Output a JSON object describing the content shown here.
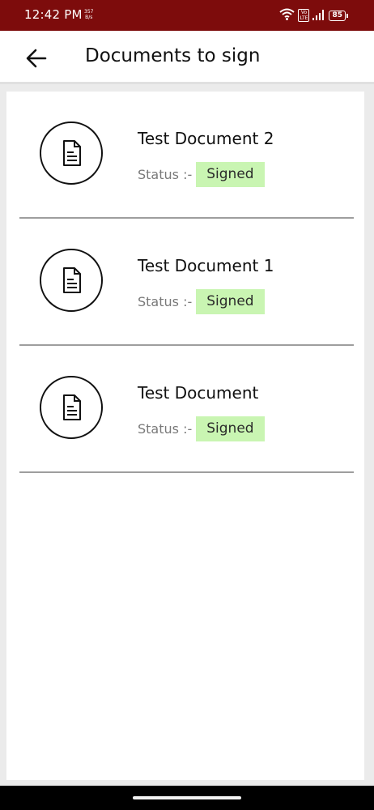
{
  "status_bar": {
    "time": "12:42 PM",
    "net_speed_value": "357",
    "net_speed_unit": "B/s",
    "volte_top": "Vo",
    "volte_bottom": "LTE",
    "battery": "85",
    "icons": [
      "wifi-icon",
      "volte-icon",
      "signal-icon",
      "battery-icon"
    ]
  },
  "app_bar": {
    "back_icon": "arrow-left-icon",
    "title": "Documents to sign"
  },
  "documents": [
    {
      "title": "Test Document 2",
      "status_label": "Status :-",
      "status": "Signed",
      "icon": "document-icon"
    },
    {
      "title": "Test Document 1",
      "status_label": "Status :-",
      "status": "Signed",
      "icon": "document-icon"
    },
    {
      "title": "Test Document",
      "status_label": "Status :-",
      "status": "Signed",
      "icon": "document-icon"
    }
  ],
  "colors": {
    "status_bar_bg": "#7d0c0c",
    "signed_badge_bg": "#c9f5b2",
    "divider": "#9e9e9e",
    "page_bg": "#ebebeb"
  }
}
